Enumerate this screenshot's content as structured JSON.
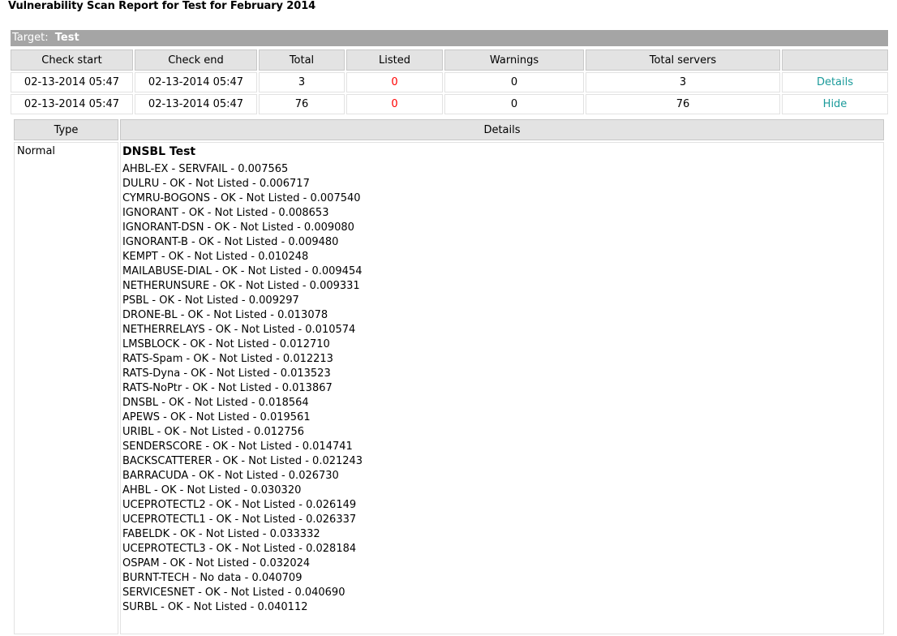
{
  "report": {
    "title": "Vulnerability Scan Report for Test for February 2014",
    "target_label": "Target:",
    "target_name": "Test"
  },
  "summary": {
    "headers": [
      "Check start",
      "Check end",
      "Total",
      "Listed",
      "Warnings",
      "Total servers",
      ""
    ],
    "rows": [
      {
        "check_start": "02-13-2014 05:47",
        "check_end": "02-13-2014 05:47",
        "total": "3",
        "listed": "0",
        "warnings": "0",
        "total_servers": "3",
        "action": "Details"
      },
      {
        "check_start": "02-13-2014 05:47",
        "check_end": "02-13-2014 05:47",
        "total": "76",
        "listed": "0",
        "warnings": "0",
        "total_servers": "76",
        "action": "Hide"
      }
    ]
  },
  "details": {
    "headers": [
      "Type",
      "Details"
    ],
    "type": "Normal",
    "test_title": "DNSBL Test",
    "results": [
      "AHBL-EX - SERVFAIL - 0.007565",
      "DULRU - OK - Not Listed - 0.006717",
      "CYMRU-BOGONS - OK - Not Listed - 0.007540",
      "IGNORANT - OK - Not Listed - 0.008653",
      "IGNORANT-DSN - OK - Not Listed - 0.009080",
      "IGNORANT-B - OK - Not Listed - 0.009480",
      "KEMPT - OK - Not Listed - 0.010248",
      "MAILABUSE-DIAL - OK - Not Listed - 0.009454",
      "NETHERUNSURE - OK - Not Listed - 0.009331",
      "PSBL - OK - Not Listed - 0.009297",
      "DRONE-BL - OK - Not Listed - 0.013078",
      "NETHERRELAYS - OK - Not Listed - 0.010574",
      "LMSBLOCK - OK - Not Listed - 0.012710",
      "RATS-Spam - OK - Not Listed - 0.012213",
      "RATS-Dyna - OK - Not Listed - 0.013523",
      "RATS-NoPtr - OK - Not Listed - 0.013867",
      "DNSBL - OK - Not Listed - 0.018564",
      "APEWS - OK - Not Listed - 0.019561",
      "URIBL - OK - Not Listed - 0.012756",
      "SENDERSCORE - OK - Not Listed - 0.014741",
      "BACKSCATTERER - OK - Not Listed - 0.021243",
      "BARRACUDA - OK - Not Listed - 0.026730",
      "AHBL - OK - Not Listed - 0.030320",
      "UCEPROTECTL2 - OK - Not Listed - 0.026149",
      "UCEPROTECTL1 - OK - Not Listed - 0.026337",
      "FABELDK - OK - Not Listed - 0.033332",
      "UCEPROTECTL3 - OK - Not Listed - 0.028184",
      "OSPAM - OK - Not Listed - 0.032024",
      "BURNT-TECH - No data - 0.040709",
      "SERVICESNET - OK - Not Listed - 0.040690",
      "SURBL - OK - Not Listed - 0.040112"
    ]
  },
  "colors": {
    "target_bar_bg": "#a5a5a5",
    "header_bg": "#e3e3e3",
    "listed_red": "#ff0000",
    "link_teal": "#1a9a9a"
  }
}
